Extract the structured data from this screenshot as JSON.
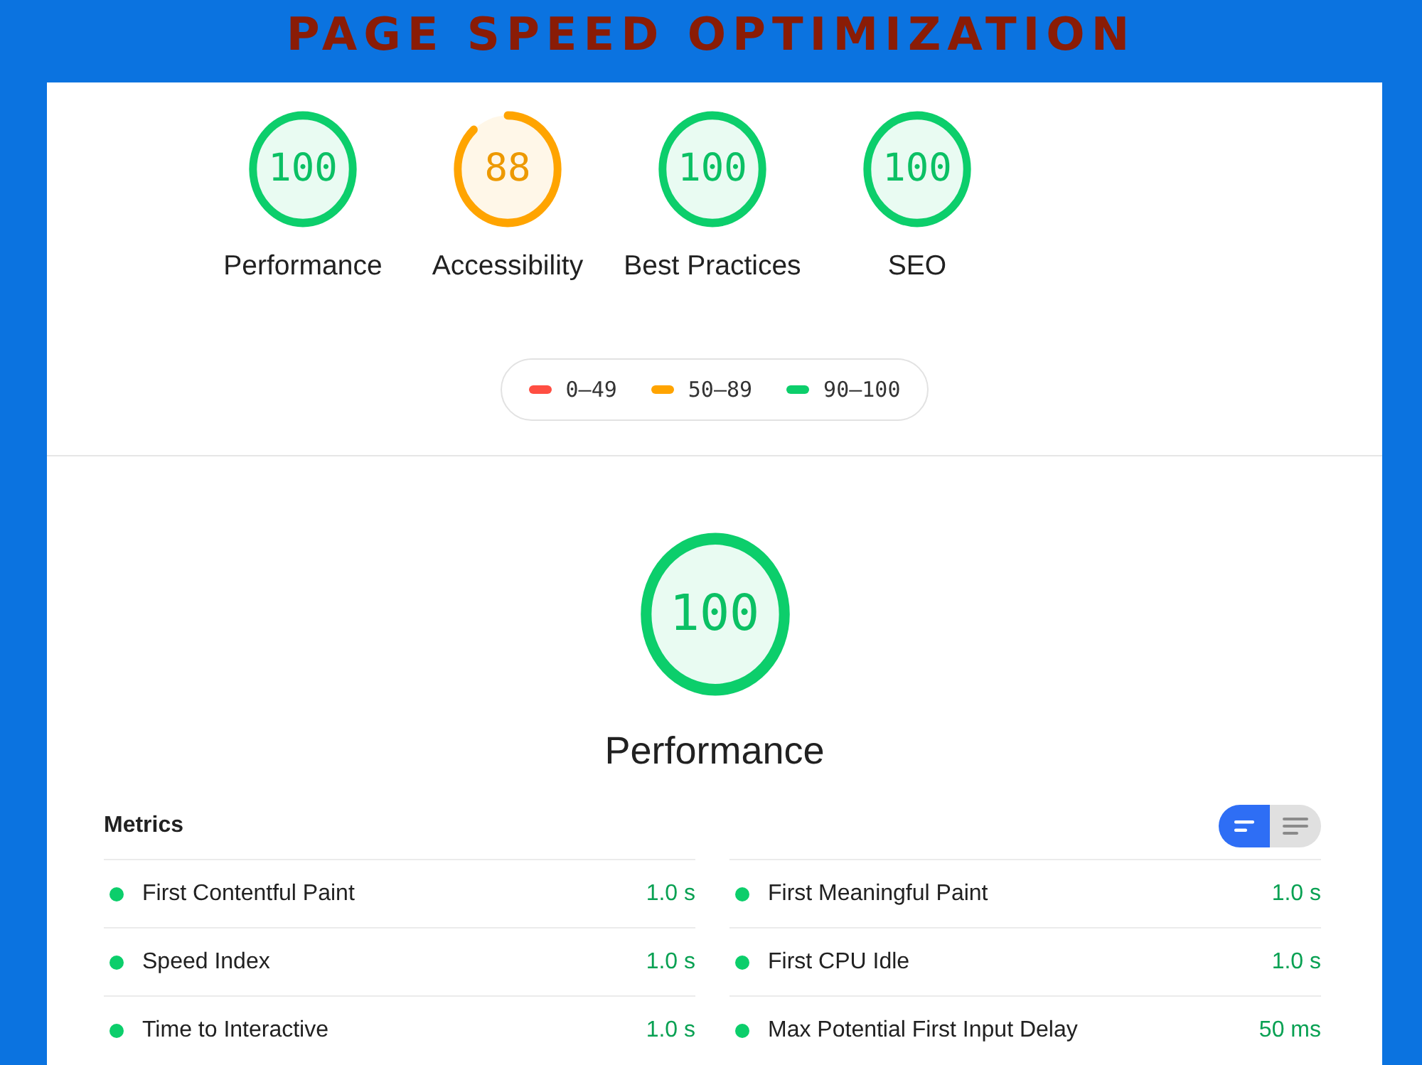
{
  "header": {
    "title": "PAGE SPEED OPTIMIZATION"
  },
  "gauges": [
    {
      "score": "100",
      "label": "Performance",
      "level": 1,
      "color": "#0cce6b"
    },
    {
      "score": "88",
      "label": "Accessibility",
      "level": 0.88,
      "color": "#ffa400"
    },
    {
      "score": "100",
      "label": "Best Practices",
      "level": 1,
      "color": "#0cce6b"
    },
    {
      "score": "100",
      "label": "SEO",
      "level": 1,
      "color": "#0cce6b"
    }
  ],
  "legend": [
    {
      "label": "0–49",
      "color": "#ff4e42"
    },
    {
      "label": "50–89",
      "color": "#ffa400"
    },
    {
      "label": "90–100",
      "color": "#0cce6b"
    }
  ],
  "performance": {
    "score": "100",
    "label": "Performance",
    "level": 1,
    "color": "#0cce6b"
  },
  "metrics": {
    "title": "Metrics",
    "view_toggle": [
      {
        "kind": "bars",
        "selected": true
      },
      {
        "kind": "lines",
        "selected": false
      }
    ],
    "items": [
      {
        "label": "First Contentful Paint",
        "value": "1.0 s",
        "color": "#0cce6b"
      },
      {
        "label": "First Meaningful Paint",
        "value": "1.0 s",
        "color": "#0cce6b"
      },
      {
        "label": "Speed Index",
        "value": "1.0 s",
        "color": "#0cce6b"
      },
      {
        "label": "First CPU Idle",
        "value": "1.0 s",
        "color": "#0cce6b"
      },
      {
        "label": "Time to Interactive",
        "value": "1.0 s",
        "color": "#0cce6b"
      },
      {
        "label": "Max Potential First Input Delay",
        "value": "50 ms",
        "color": "#0cce6b"
      }
    ]
  }
}
